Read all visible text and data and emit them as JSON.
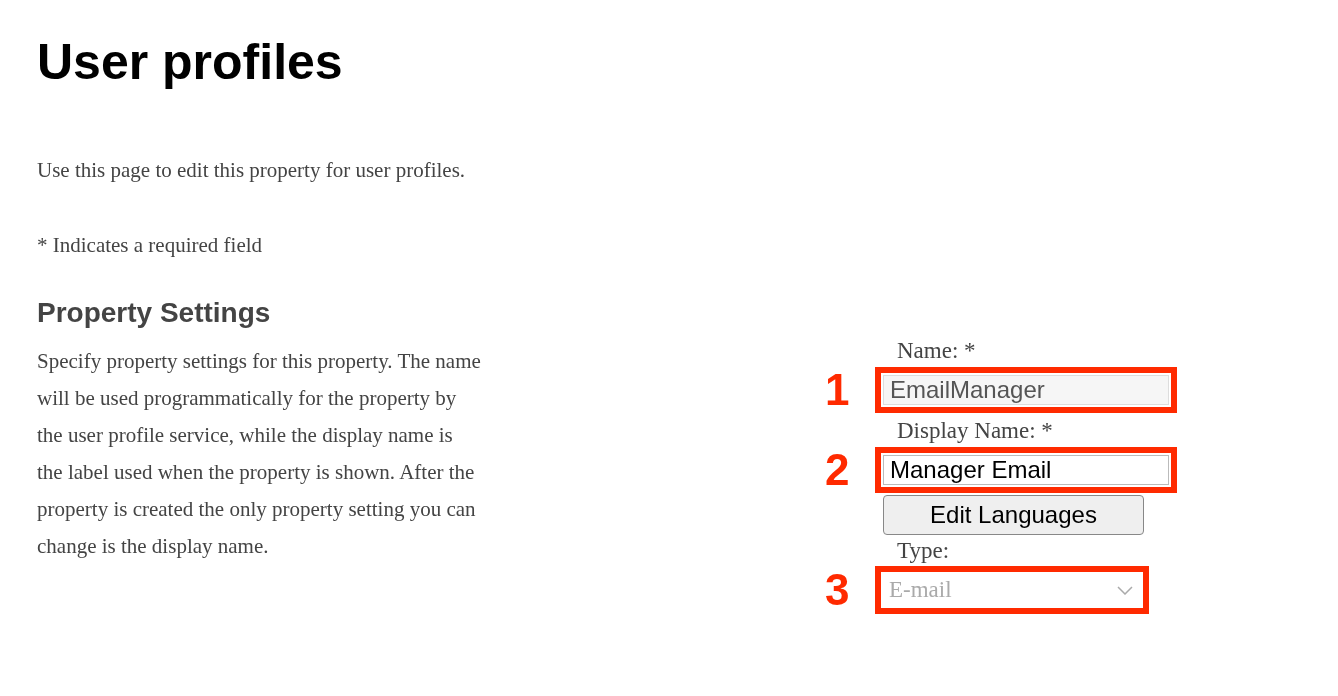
{
  "page": {
    "title": "User profiles",
    "intro": "Use this page to edit this property for user profiles.",
    "required_note": "* Indicates a required field"
  },
  "section": {
    "heading": "Property Settings",
    "description": "Specify property settings for this property. The name will be used programmatically for the property by the user profile service, while the display name is the label used when the property is shown. After the property is created the only property setting you can change is the display name."
  },
  "fields": [
    {
      "kind": "text",
      "label": "Name: *",
      "value": "EmailManager",
      "disabled": true,
      "callout": "1"
    },
    {
      "kind": "text",
      "label": "Display Name: *",
      "value": "Manager Email",
      "disabled": false,
      "callout": "2"
    },
    {
      "kind": "button",
      "label": "Edit Languages"
    },
    {
      "kind": "select",
      "label": "Type:",
      "value": "E-mail",
      "disabled": true,
      "callout": "3"
    }
  ]
}
